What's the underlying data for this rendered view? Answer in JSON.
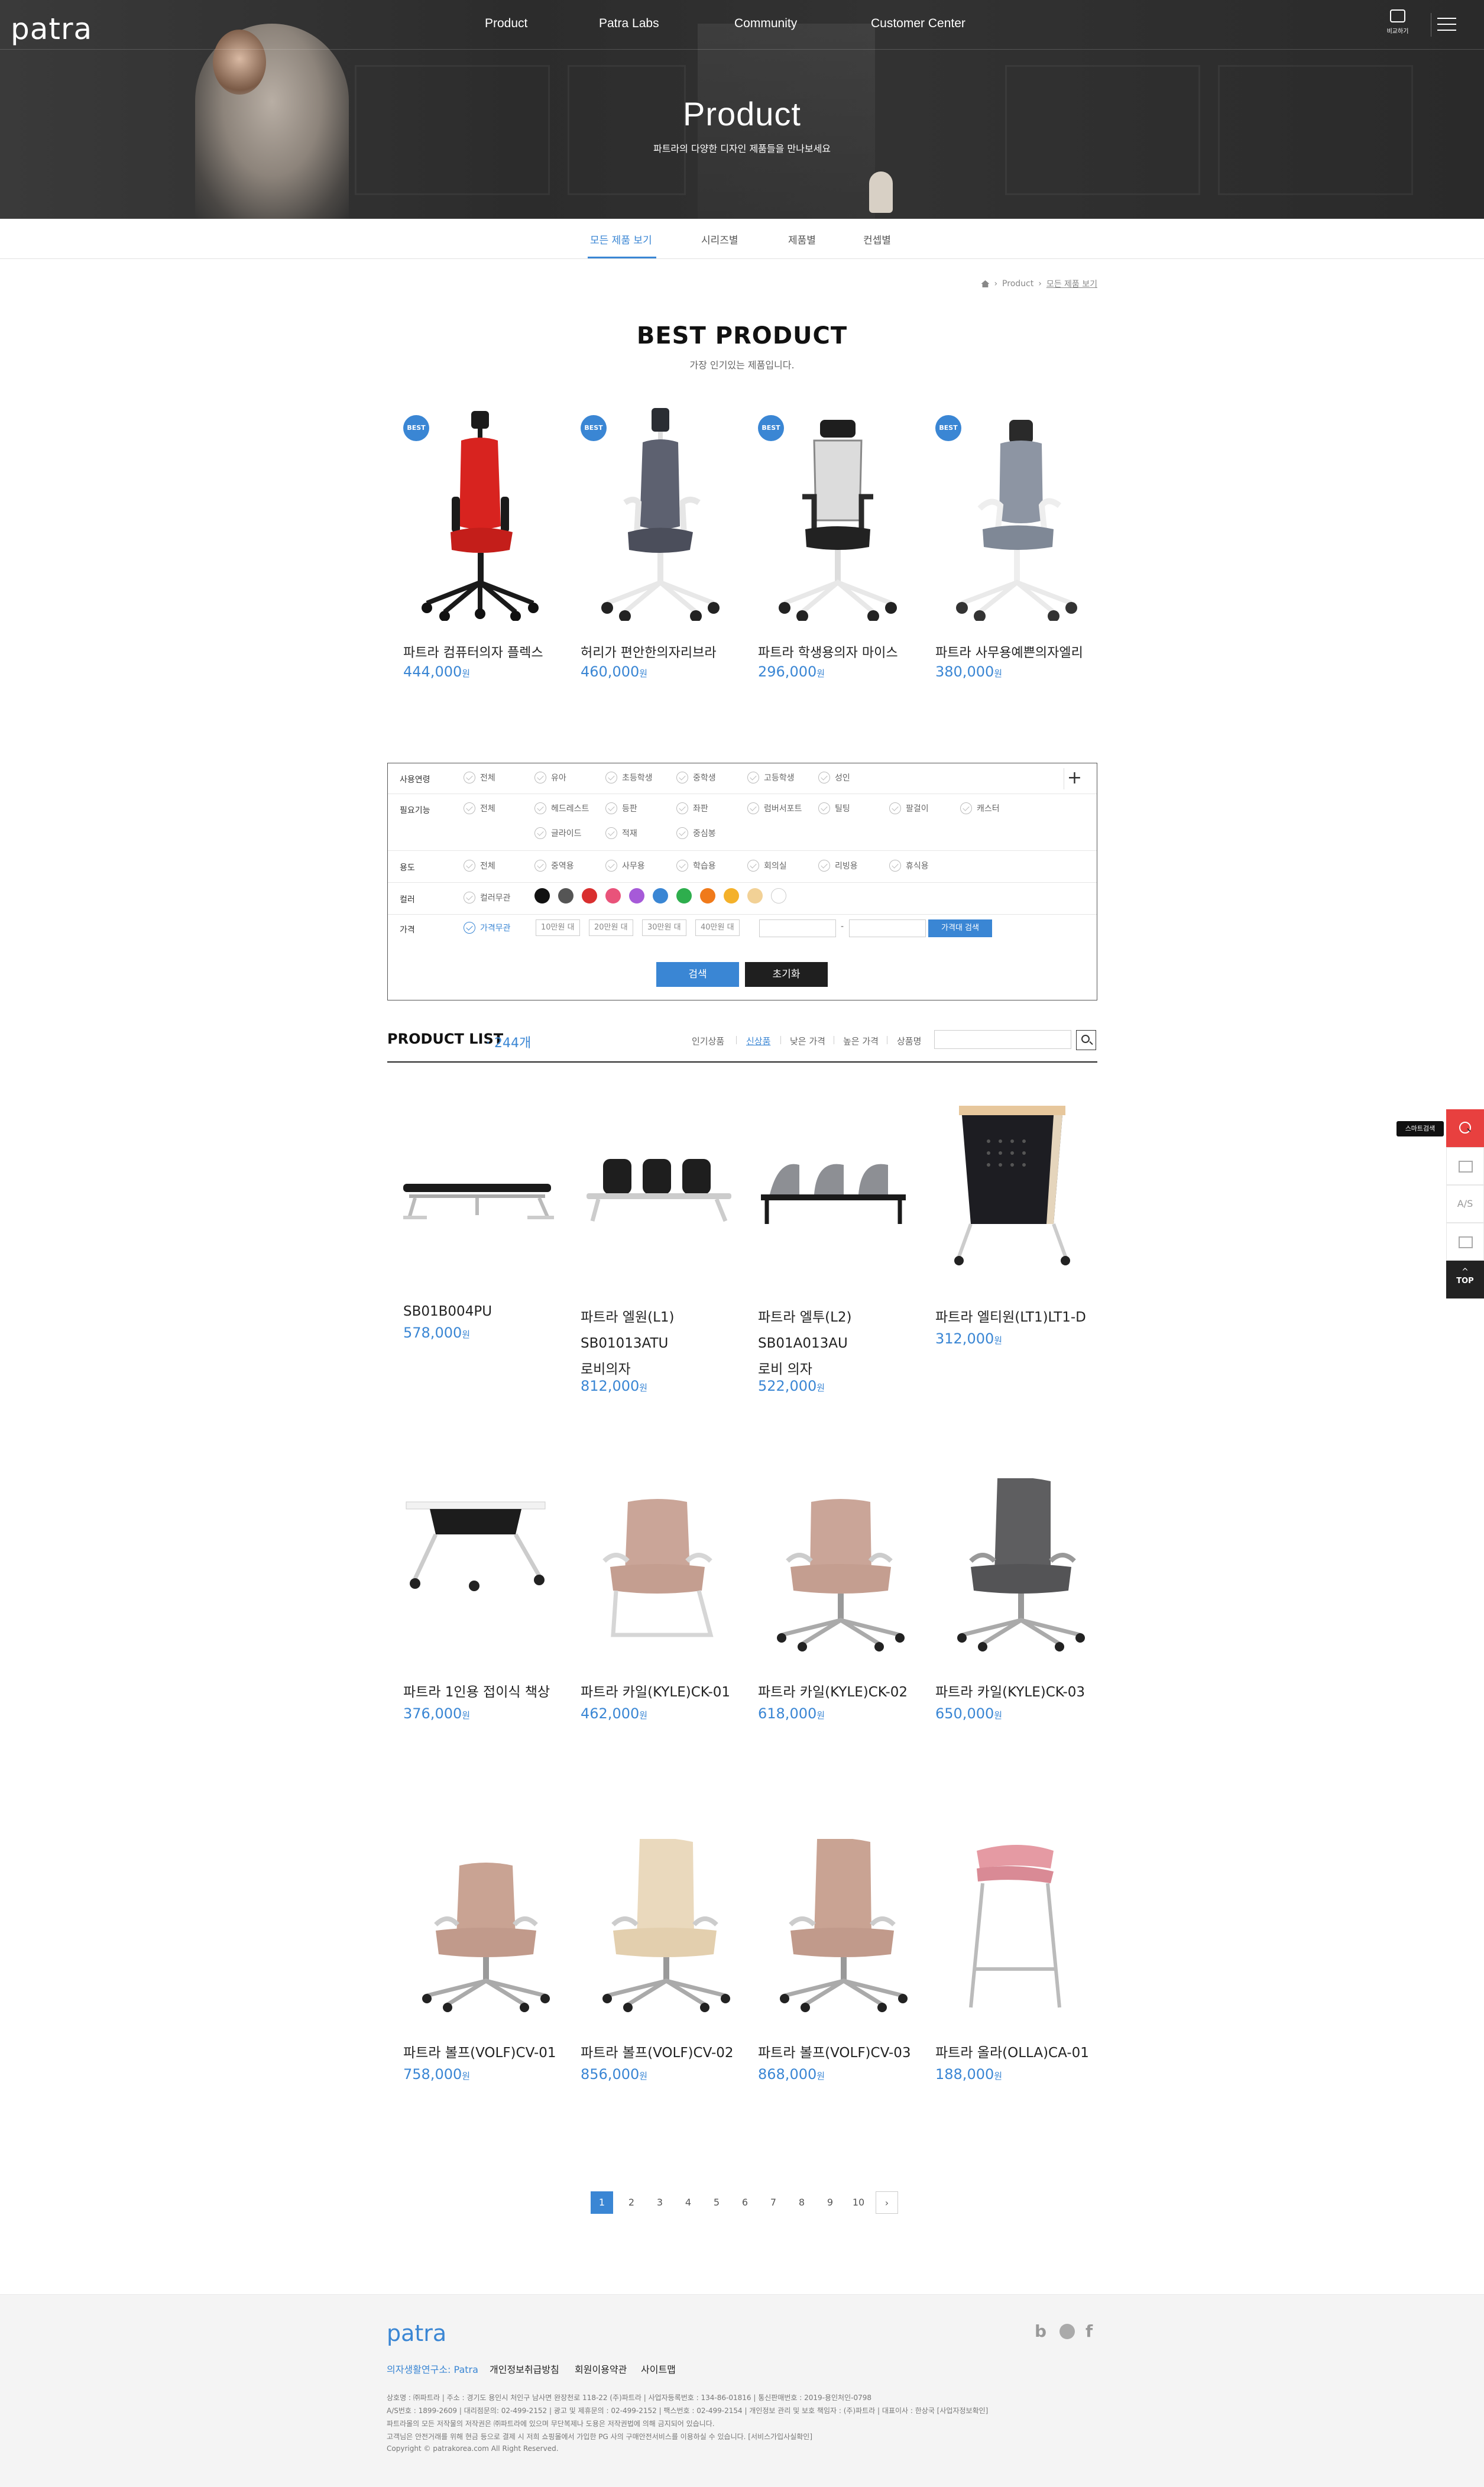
{
  "header": {
    "logo": "patra",
    "nav": [
      "Product",
      "Patra Labs",
      "Community",
      "Customer Center"
    ],
    "compare_label": "비교하기"
  },
  "hero": {
    "title": "Product",
    "subtitle": "파트라의 다양한 디자인 제품들을 만나보세요"
  },
  "tabs": [
    "모든 제품 보기",
    "시리즈별",
    "제품별",
    "컨셉별"
  ],
  "breadcrumb": [
    "Product",
    "모든 제품 보기"
  ],
  "best": {
    "title": "BEST PRODUCT",
    "subtitle": "가장 인기있는 제품입니다.",
    "badge": "BEST",
    "currency": "원",
    "items": [
      {
        "name": "파트라 컴퓨터의자 플렉스",
        "price": "444,000"
      },
      {
        "name": "허리가 편안한의자리브라",
        "price": "460,000"
      },
      {
        "name": "파트라 학생용의자 마이스",
        "price": "296,000"
      },
      {
        "name": "파트라 사무용예쁜의자엘리",
        "price": "380,000"
      }
    ]
  },
  "filter": {
    "rows": [
      {
        "label": "사용연령",
        "options": [
          "전체",
          "유아",
          "초등학생",
          "중학생",
          "고등학생",
          "성인"
        ]
      },
      {
        "label": "필요기능",
        "options": [
          "전체",
          "헤드레스트",
          "등판",
          "좌판",
          "럼버서포트",
          "틸팅",
          "팔걸이",
          "캐스터",
          "글라이드",
          "적재",
          "중심봉"
        ]
      },
      {
        "label": "용도",
        "options": [
          "전체",
          "중역용",
          "사무용",
          "학습용",
          "회의실",
          "리빙용",
          "휴식용"
        ]
      },
      {
        "label": "컬러",
        "options": [
          "컬러무관"
        ]
      },
      {
        "label": "가격",
        "options": [
          "가격무관"
        ]
      }
    ],
    "colors": [
      "#111111",
      "#555555",
      "#d92f2f",
      "#e9537a",
      "#a65ad8",
      "#3a86d4",
      "#2eae4d",
      "#f07a1a",
      "#f4b12a",
      "#f2d196",
      "#ffffff"
    ],
    "price_buttons": [
      "10만원 대",
      "20만원 대",
      "30만원 대",
      "40만원 대"
    ],
    "price_separator": "-",
    "price_search": "가격대 검색",
    "search": "검색",
    "reset": "초기화"
  },
  "product_list": {
    "title": "PRODUCT LIST",
    "count": "· 244개",
    "sort": [
      "인기상품",
      "신상품",
      "낮은 가격",
      "높은 가격",
      "상품명"
    ],
    "currency": "원",
    "items": [
      {
        "name": "SB01B004PU",
        "price": "578,000"
      },
      {
        "name": "파트라 엘원(L1)\nSB01013ATU\n로비의자",
        "price": "812,000"
      },
      {
        "name": "파트라 엘투(L2)\nSB01A013AU\n로비 의자",
        "price": "522,000"
      },
      {
        "name": "파트라 엘티원(LT1)LT1-D",
        "price": "312,000"
      },
      {
        "name": "파트라 1인용 접이식 책상",
        "price": "376,000"
      },
      {
        "name": "파트라 카일(KYLE)CK-01",
        "price": "462,000"
      },
      {
        "name": "파트라 카일(KYLE)CK-02",
        "price": "618,000"
      },
      {
        "name": "파트라 카일(KYLE)CK-03",
        "price": "650,000"
      },
      {
        "name": "파트라 볼프(VOLF)CV-01",
        "price": "758,000"
      },
      {
        "name": "파트라 볼프(VOLF)CV-02",
        "price": "856,000"
      },
      {
        "name": "파트라 볼프(VOLF)CV-03",
        "price": "868,000"
      },
      {
        "name": "파트라 올라(OLLA)CA-01",
        "price": "188,000"
      }
    ]
  },
  "quick": {
    "tooltip": "스마트검색",
    "as": "A/S",
    "top": "TOP"
  },
  "pagination": [
    "1",
    "2",
    "3",
    "4",
    "5",
    "6",
    "7",
    "8",
    "9",
    "10"
  ],
  "footer": {
    "logo": "patra",
    "links": [
      "의자생활연구소: Patra",
      "개인정보취급방침",
      "회원이용약관",
      "사이트맵"
    ],
    "sns": [
      "b",
      "f"
    ],
    "info": [
      "상호명 : ㈜파트라   |   주소 : 경기도 용인시 처인구 남사면 완장천로 118-22 (주)파트라   |   사업자등록번호 : 134-86-01816   |   통신판매번호 : 2019-용인처인-0798",
      "A/S번호 : 1899-2609   |   대리점문의: 02-499-2152   |   광고 및 제휴문의 : 02-499-2152   |   팩스번호 : 02-499-2154   |   개인정보 관리 및 보호 책임자 : (주)파트라   |   대표이사 : 한상국 [사업자정보확인]",
      "파트라몰의 모든 저작물의 저작권은 ㈜파트라에 있으며 무단복제나 도용은 저작권법에 의해 금지되어 있습니다.",
      "고객님은 안전거래를 위해 현금 등으로 결제 시 저희 쇼핑몰에서 가입한 PG 사의 구매안전서비스를 이용하실 수 있습니다. [서비스가입사실확인]",
      "Copyright © patrakorea.com All Right Reserved."
    ]
  }
}
